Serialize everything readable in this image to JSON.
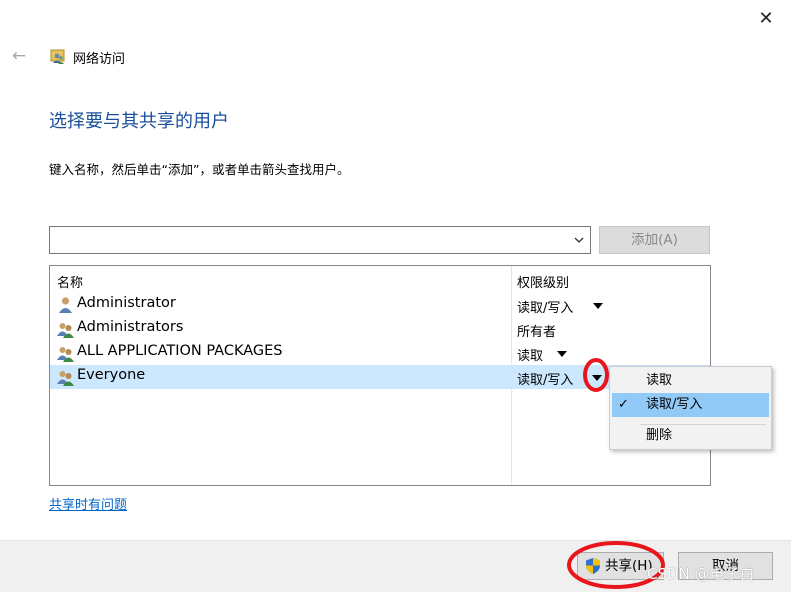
{
  "window": {
    "close_glyph": "✕",
    "back_glyph": "←",
    "title": "网络访问"
  },
  "heading": "选择要与其共享的用户",
  "instruction": "键入名称，然后单击“添加”，或者单击箭头查找用户。",
  "combo": {
    "value": ""
  },
  "add_button": "添加(A)",
  "list": {
    "headers": [
      "名称",
      "权限级别"
    ],
    "rows": [
      {
        "name": "Administrator",
        "permission": "读取/写入",
        "has_dropdown": true,
        "icon": "single-user-icon"
      },
      {
        "name": "Administrators",
        "permission": "所有者",
        "has_dropdown": false,
        "icon": "group-users-icon"
      },
      {
        "name": "ALL APPLICATION PACKAGES",
        "permission": "读取",
        "has_dropdown": true,
        "icon": "group-users-icon"
      },
      {
        "name": "Everyone",
        "permission": "读取/写入",
        "has_dropdown": true,
        "icon": "group-users-icon",
        "selected": true
      }
    ]
  },
  "dropdown_menu": {
    "items": [
      {
        "label": "读取",
        "checked": false
      },
      {
        "label": "读取/写入",
        "checked": true
      },
      {
        "label": "删除",
        "checked": false
      }
    ],
    "check_glyph": "✓"
  },
  "help_link": "共享时有问题",
  "footer": {
    "share_button": "共享(H)",
    "cancel_button": "取消"
  },
  "watermark": "CSDN @电子白",
  "colors": {
    "heading": "#1a4f9c",
    "selection": "#cce8ff",
    "menu_highlight": "#91c9f7",
    "link": "#0066cc",
    "annotation": "#e8151b"
  }
}
